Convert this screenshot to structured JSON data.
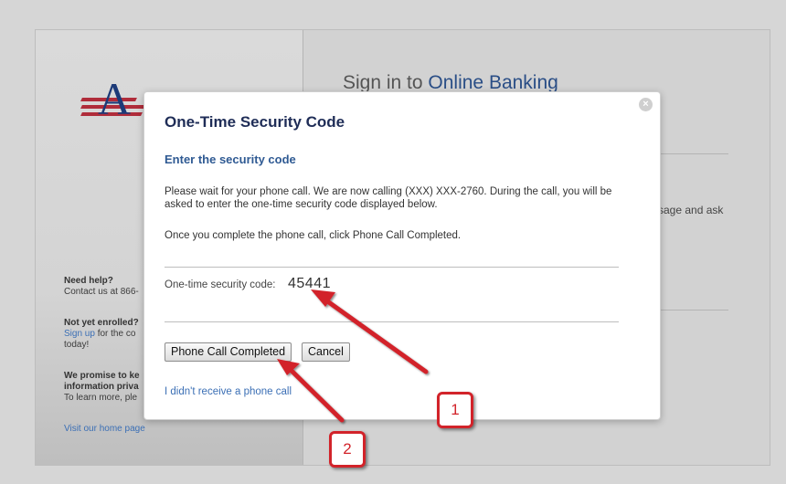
{
  "background_page": {
    "heading_prefix": "Sign in to ",
    "heading_accent": "Online Banking",
    "partial_text": "sage and ask",
    "logo_letters": "A",
    "sidebar": {
      "help_title": "Need help?",
      "help_text": "Contact us at 866-",
      "enroll_title": "Not yet enrolled?",
      "enroll_link": "Sign up",
      "enroll_text": " for the co",
      "enroll_text2": "today!",
      "promise_title1": "We promise to ke",
      "promise_title2": "information priva",
      "promise_text": "To learn more, ple",
      "home_link": "Visit our home page"
    }
  },
  "modal": {
    "close_glyph": "×",
    "title": "One-Time Security Code",
    "subtitle": "Enter the security code",
    "paragraph1": "Please wait for your phone call. We are now calling (XXX) XXX-2760. During the call, you will be asked to enter the one-time security code displayed below.",
    "paragraph2": "Once you complete the phone call, click Phone Call Completed.",
    "code_label": "One-time security code:",
    "code_value": "45441",
    "buttons": {
      "completed": "Phone Call Completed",
      "cancel": "Cancel"
    },
    "no_call_link": "I didn't receive a phone call"
  },
  "annotations": {
    "callout_1": "1",
    "callout_2": "2",
    "color": "#d2232a"
  }
}
